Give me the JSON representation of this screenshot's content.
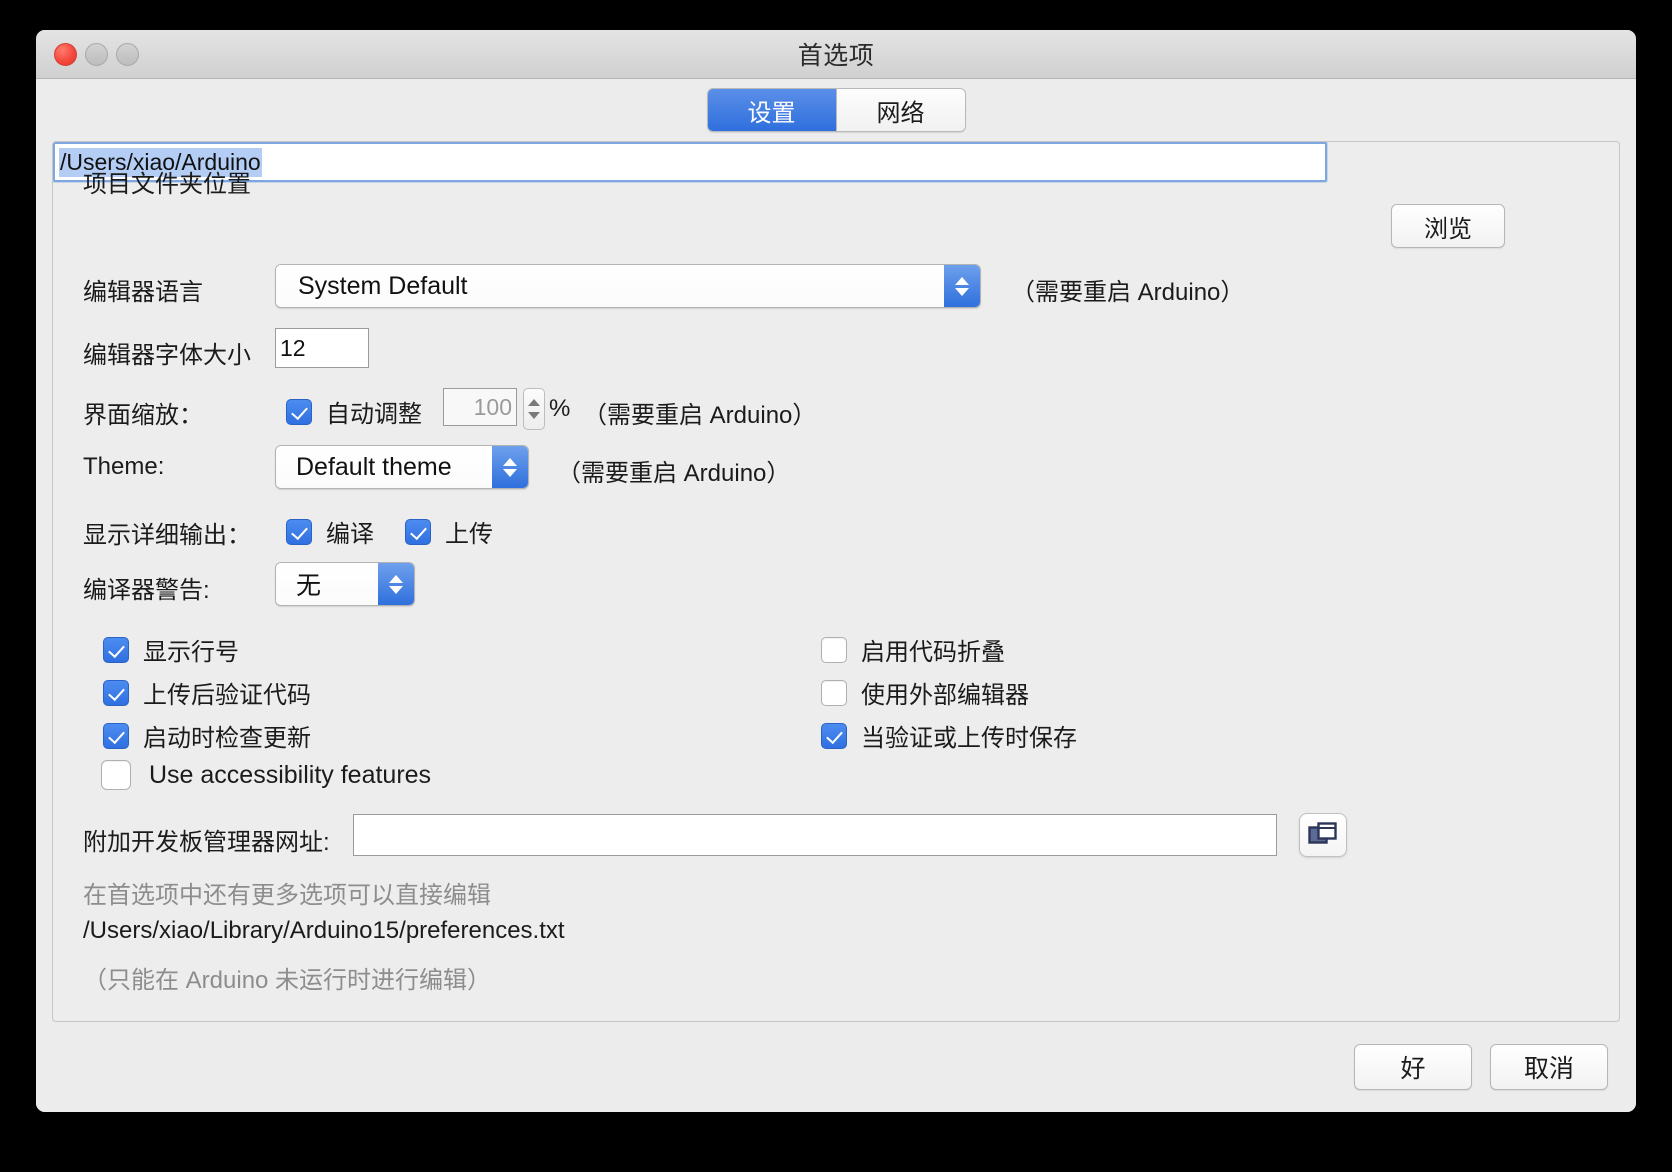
{
  "window": {
    "title": "首选项",
    "traffic": {
      "close": "close-button",
      "minimize": "minimize-button",
      "zoom": "zoom-button"
    }
  },
  "tabs": [
    {
      "label": "设置",
      "active": true
    },
    {
      "label": "网络",
      "active": false
    }
  ],
  "settings": {
    "sketchbook": {
      "label": "项目文件夹位置",
      "value": "/Users/xiao/Arduino",
      "browse_label": "浏览"
    },
    "editor_language": {
      "label": "编辑器语言",
      "value": "System Default",
      "note": "（需要重启 Arduino）"
    },
    "editor_font_size": {
      "label": "编辑器字体大小",
      "value": "12"
    },
    "interface_scale": {
      "label": "界面缩放：",
      "auto_label": "自动调整",
      "auto_checked": true,
      "percent_value": "100",
      "percent_symbol": "%",
      "note": "（需要重启 Arduino）"
    },
    "theme": {
      "label": "Theme:",
      "value": "Default theme",
      "note": "（需要重启 Arduino）"
    },
    "verbose_output": {
      "label": "显示详细输出：",
      "compile_label": "编译",
      "compile_checked": true,
      "upload_label": "上传",
      "upload_checked": true
    },
    "compiler_warnings": {
      "label": "编译器警告:",
      "value": "无"
    },
    "checkbox_left": [
      {
        "label": "显示行号",
        "checked": true
      },
      {
        "label": "上传后验证代码",
        "checked": true
      },
      {
        "label": "启动时检查更新",
        "checked": true
      }
    ],
    "checkbox_right": [
      {
        "label": "启用代码折叠",
        "checked": false
      },
      {
        "label": "使用外部编辑器",
        "checked": false
      },
      {
        "label": "当验证或上传时保存",
        "checked": true
      }
    ],
    "accessibility": {
      "label": "Use accessibility features",
      "checked": false
    },
    "board_urls": {
      "label": "附加开发板管理器网址:",
      "value": "",
      "icon": "windows-icon"
    },
    "footer": {
      "line1": "在首选项中还有更多选项可以直接编辑",
      "line2": "/Users/xiao/Library/Arduino15/preferences.txt",
      "line3": "（只能在 Arduino 未运行时进行编辑）"
    }
  },
  "buttons": {
    "ok": "好",
    "cancel": "取消"
  },
  "colors": {
    "accent": "#2f6fdd",
    "checkbox_on": "#3d7ae8",
    "selection": "#b4cdf5",
    "close_red": "#f4453a",
    "icon_navy": "#3f4f7f"
  }
}
